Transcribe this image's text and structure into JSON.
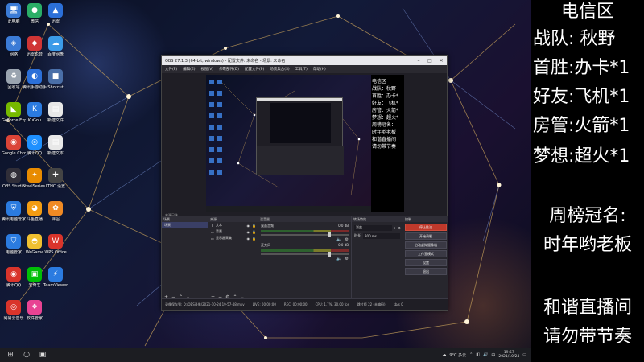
{
  "desktop": {
    "icons": [
      {
        "label": "此电脑",
        "symbol": "🖥",
        "color": "#3b7bd6"
      },
      {
        "label": "微信",
        "symbol": "●",
        "color": "#2aae67"
      },
      {
        "label": "迅雷",
        "symbol": "▲",
        "color": "#2b6fd8"
      },
      {
        "label": "网络",
        "symbol": "◈",
        "color": "#3b7bd6"
      },
      {
        "label": "迅雷影音",
        "symbol": "◆",
        "color": "#d03535"
      },
      {
        "label": "百度网盘",
        "symbol": "☁",
        "color": "#3b9be8"
      },
      {
        "label": "回收站",
        "symbol": "♻",
        "color": "#9aa4b0"
      },
      {
        "label": "腾讯手游助手",
        "symbol": "◐",
        "color": "#2b6fd8"
      },
      {
        "label": "Shotcut",
        "symbol": "■",
        "color": "#4a6fa8"
      },
      {
        "label": "GeForce Experience",
        "symbol": "◣",
        "color": "#76b900"
      },
      {
        "label": "KuGou",
        "symbol": "K",
        "color": "#2b7be0"
      },
      {
        "label": "新建文件",
        "symbol": "▤",
        "color": "#e8e8e8"
      },
      {
        "label": "Google Chrome",
        "symbol": "◉",
        "color": "#db4437"
      },
      {
        "label": "腾讯QQ",
        "symbol": "◎",
        "color": "#1e90ff"
      },
      {
        "label": "新建文本",
        "symbol": "▤",
        "color": "#e8e8e8"
      },
      {
        "label": "OBS Studio",
        "symbol": "◍",
        "color": "#302e38"
      },
      {
        "label": "SteelSeries GG",
        "symbol": "✦",
        "color": "#e88b00"
      },
      {
        "label": "LTHC 设置",
        "symbol": "✚",
        "color": "#444"
      },
      {
        "label": "腾讯电脑管家",
        "symbol": "⛨",
        "color": "#2b7be0"
      },
      {
        "label": "斗鱼直播",
        "symbol": "◕",
        "color": "#f39c12"
      },
      {
        "label": "伴侣",
        "symbol": "✿",
        "color": "#f08a24"
      },
      {
        "label": "电脑管家",
        "symbol": "⛉",
        "color": "#2b7be0"
      },
      {
        "label": "WeGame",
        "symbol": "◓",
        "color": "#f0c030"
      },
      {
        "label": "WPS Office",
        "symbol": "W",
        "color": "#d9342b"
      },
      {
        "label": "腾讯QQ",
        "symbol": "◉",
        "color": "#d9342b"
      },
      {
        "label": "爱奇艺",
        "symbol": "▣",
        "color": "#00be06"
      },
      {
        "label": "TeamViewer",
        "symbol": "⚡",
        "color": "#2b7be0"
      },
      {
        "label": "网易云音乐",
        "symbol": "◎",
        "color": "#d9342b"
      },
      {
        "label": "软件管家",
        "symbol": "❖",
        "color": "#e84393"
      }
    ]
  },
  "obs": {
    "title": "OBS 27.1.3 (64-bit, windows) - 配置文件: 未命名 - 场景: 未命名",
    "menu": [
      "文件(F)",
      "编辑(E)",
      "视图(V)",
      "停靠部件(D)",
      "配置文件(P)",
      "场景集合(S)",
      "工具(T)",
      "帮助(H)"
    ],
    "preview_side": [
      "电信区",
      "战队：秋野",
      "首胜：办卡*",
      "好友：飞机*",
      "房管：火箭*",
      "梦想：超火*",
      "",
      "周榜冠名：",
      "时年哟老板",
      "",
      "和谐直播间",
      "请勿带节奏"
    ],
    "source_label": "来源已选",
    "docks": {
      "scenes_title": "场景",
      "scenes": [
        "场景"
      ],
      "sources_title": "来源",
      "sources": [
        {
          "icon": "T",
          "name": "文本"
        },
        {
          "icon": "▭",
          "name": "背景"
        },
        {
          "icon": "▭",
          "name": "显示器采集"
        }
      ],
      "mixer_title": "混音器",
      "mixer": [
        {
          "name": "桌面音频",
          "db": "0.0 dB"
        },
        {
          "name": "麦克风",
          "db": "0.0 dB"
        }
      ],
      "transitions_title": "转场特效",
      "transition_type": "渐变",
      "transition_duration_label": "时长",
      "transition_duration": "300 ms",
      "controls_title": "控制",
      "controls": [
        "停止推流",
        "开始录制",
        "启动虚拟摄像机",
        "工作室模式",
        "设置",
        "退出"
      ]
    },
    "status": {
      "recording_path": "录像保存到: D:/OBS录像/2021-10-24 19-57-48.mkv",
      "live": "LIVE: 00:00:00",
      "rec": "REC: 00:00:00",
      "cpu": "CPU: 1.7%, 30.00 fps",
      "dropped": "跳过帧 22 (未编码)",
      "bitrate": "kb/s 0"
    }
  },
  "info_panel": {
    "lines": [
      {
        "text": "电信区",
        "align": "center"
      },
      {
        "text": "战队:   秋野",
        "align": "left"
      },
      {
        "text": "首胜:办卡*1",
        "align": "left"
      },
      {
        "text": "好友:飞机*1",
        "align": "left"
      },
      {
        "text": "房管:火箭*1",
        "align": "left"
      },
      {
        "text": "梦想:超火*1",
        "align": "left"
      },
      {
        "text": "周榜冠名:",
        "align": "center"
      },
      {
        "text": "时年哟老板",
        "align": "center"
      },
      {
        "text": "和谐直播间",
        "align": "center"
      },
      {
        "text": "请勿带节奏",
        "align": "center"
      }
    ]
  },
  "taskbar": {
    "start_symbol": "⊞",
    "search_symbol": "○",
    "taskview_symbol": "▣",
    "weather": "9°C 多云",
    "ime": "中",
    "time": "19:57",
    "date": "2021/10/24"
  }
}
